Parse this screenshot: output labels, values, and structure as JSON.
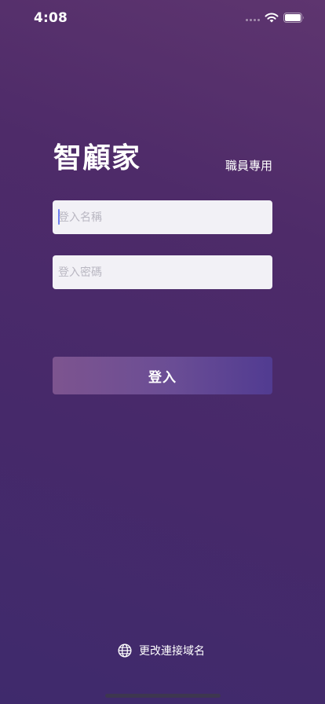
{
  "status_bar": {
    "time": "4:08"
  },
  "icons": {
    "wifi": "wifi-icon",
    "battery": "battery-icon",
    "globe": "globe-icon"
  },
  "header": {
    "app_title": "智顧家",
    "staff_label": "職員專用"
  },
  "form": {
    "username_placeholder": "登入名稱",
    "username_value": "",
    "password_placeholder": "登入密碼",
    "password_value": "",
    "login_label": "登入"
  },
  "footer": {
    "change_domain_label": "更改連接域名"
  },
  "colors": {
    "background_top": "#5e356f",
    "background_bottom": "#3f2a6c",
    "field_background": "#f2f1f6",
    "button_gradient_start": "#7d548f",
    "button_gradient_end": "#513b91",
    "caret": "#6e7ef0"
  }
}
